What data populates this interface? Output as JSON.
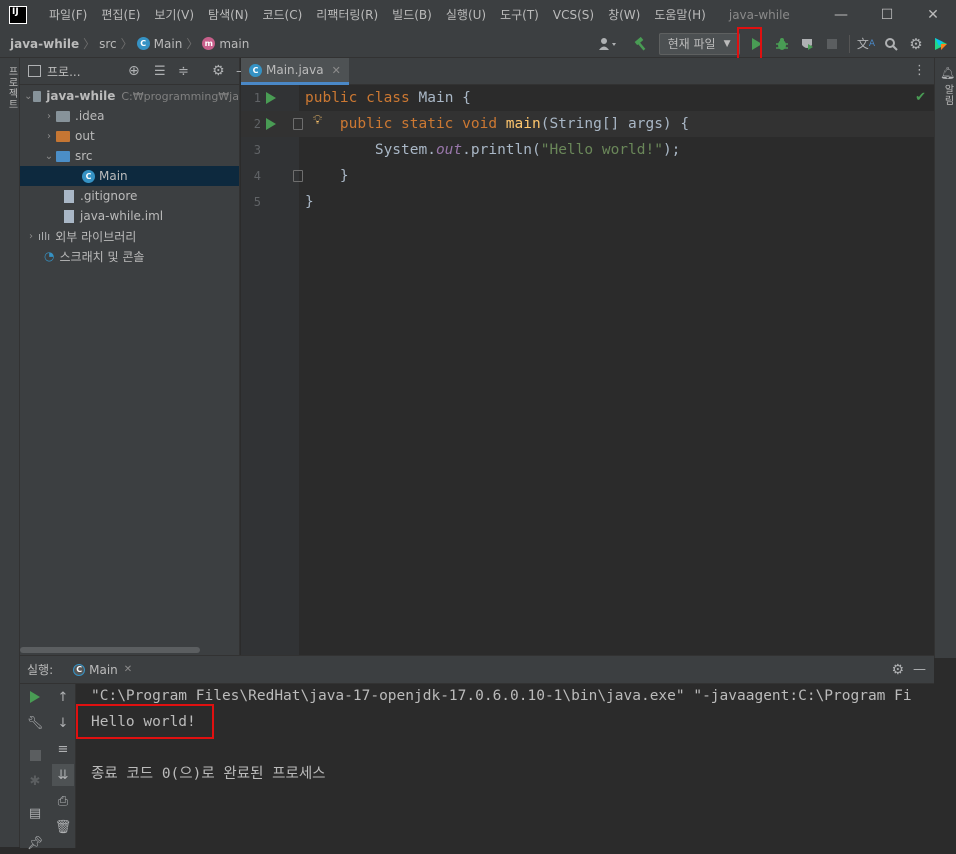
{
  "app": {
    "logo_text": "IJ",
    "window_title": "java-while",
    "menu": [
      "파일(F)",
      "편집(E)",
      "보기(V)",
      "탐색(N)",
      "코드(C)",
      "리팩터링(R)",
      "빌드(B)",
      "실행(U)",
      "도구(T)",
      "VCS(S)",
      "창(W)",
      "도움말(H)"
    ],
    "window_controls": {
      "minimize": "—",
      "maximize": "☐",
      "close": "✕"
    }
  },
  "navbar": {
    "breadcrumbs": [
      "java-while",
      "src",
      "Main",
      "main"
    ],
    "run_config": "현재 파일"
  },
  "left_strip": {
    "project_label": "프로젝트"
  },
  "right_strip": {
    "notifications_label": "알림"
  },
  "project": {
    "title": "프로...",
    "tree": [
      {
        "label": "java-while",
        "path": "C:₩programming₩ja",
        "type": "module"
      },
      {
        "label": ".idea",
        "type": "folder-grey"
      },
      {
        "label": "out",
        "type": "folder-orange"
      },
      {
        "label": "src",
        "type": "folder-blue"
      },
      {
        "label": "Main",
        "type": "class"
      },
      {
        "label": ".gitignore",
        "type": "file"
      },
      {
        "label": "java-while.iml",
        "type": "file"
      },
      {
        "label": "외부 라이브러리",
        "type": "library"
      },
      {
        "label": "스크래치 및 콘솔",
        "type": "scratch"
      }
    ]
  },
  "editor": {
    "tab": "Main.java",
    "lines": [
      {
        "no": "1",
        "parts": [
          [
            "kw",
            "public class "
          ],
          [
            "",
            "Main {"
          ]
        ]
      },
      {
        "no": "2",
        "parts": [
          [
            "",
            "    "
          ],
          [
            "kw",
            "public static void "
          ],
          [
            "fn",
            "main"
          ],
          [
            "",
            "(String[] args) {"
          ]
        ]
      },
      {
        "no": "3",
        "parts": [
          [
            "",
            "        System."
          ],
          [
            "it",
            "out"
          ],
          [
            "",
            ".println("
          ],
          [
            "st",
            "\"Hello world!\""
          ],
          [
            "",
            ");"
          ]
        ]
      },
      {
        "no": "4",
        "parts": [
          [
            "",
            "    }"
          ]
        ]
      },
      {
        "no": "5",
        "parts": [
          [
            "",
            "}"
          ]
        ]
      }
    ]
  },
  "run": {
    "label": "실행:",
    "tab": "Main",
    "output": [
      "\"C:\\Program Files\\RedHat\\java-17-openjdk-17.0.6.0.10-1\\bin\\java.exe\" \"-javaagent:C:\\Program Fi",
      "Hello world!",
      "",
      "종료 코드 0(으)로 완료된 프로세스"
    ]
  }
}
